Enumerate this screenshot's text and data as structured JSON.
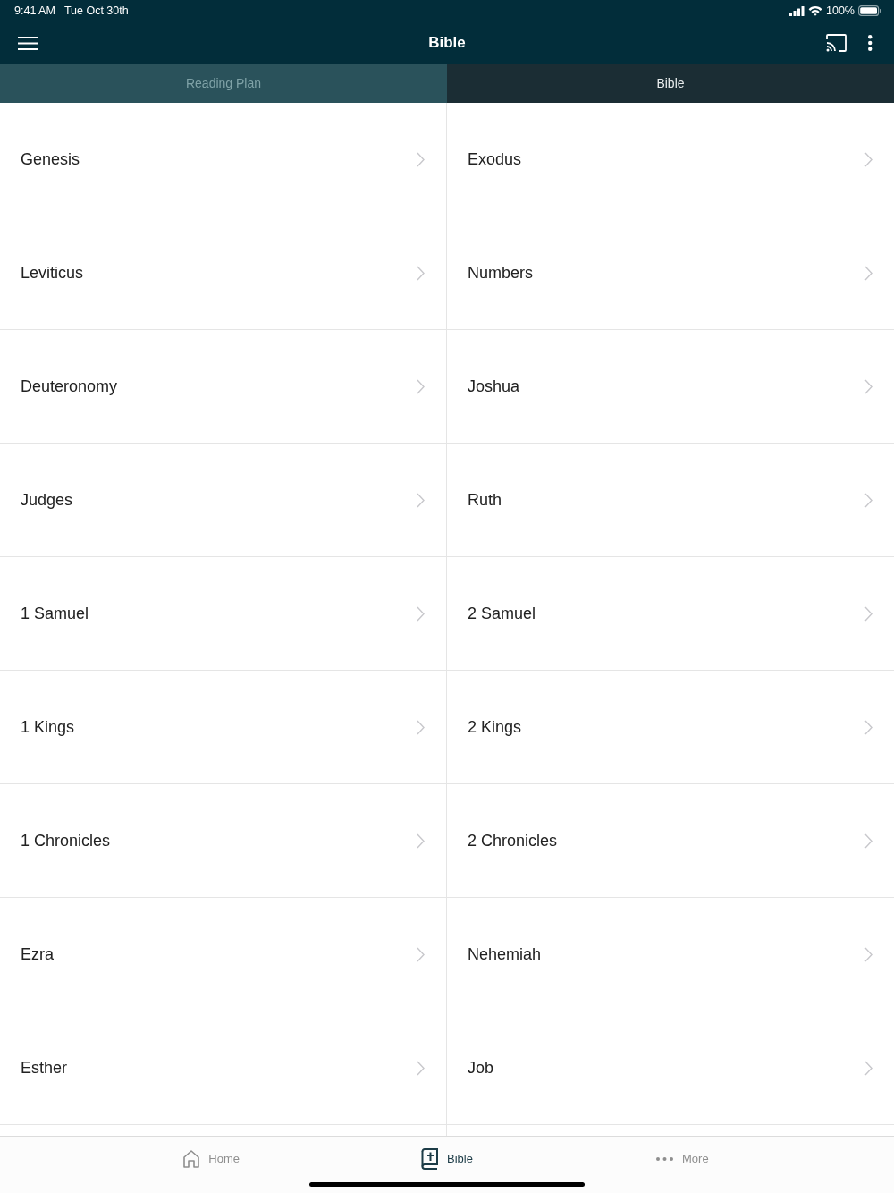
{
  "status_bar": {
    "time": "9:41 AM",
    "date": "Tue Oct 30th",
    "battery": "100%"
  },
  "app_bar": {
    "title": "Bible"
  },
  "tabs": [
    {
      "label": "Reading Plan",
      "selected": false
    },
    {
      "label": "Bible",
      "selected": true
    }
  ],
  "books": [
    "Genesis",
    "Exodus",
    "Leviticus",
    "Numbers",
    "Deuteronomy",
    "Joshua",
    "Judges",
    "Ruth",
    "1 Samuel",
    "2 Samuel",
    "1 Kings",
    "2 Kings",
    "1 Chronicles",
    "2 Chronicles",
    "Ezra",
    "Nehemiah",
    "Esther",
    "Job"
  ],
  "bottom_nav": [
    {
      "kind": "home",
      "label": "Home",
      "selected": false
    },
    {
      "kind": "bible",
      "label": "Bible",
      "selected": true
    },
    {
      "kind": "more",
      "label": "More",
      "selected": false
    }
  ]
}
